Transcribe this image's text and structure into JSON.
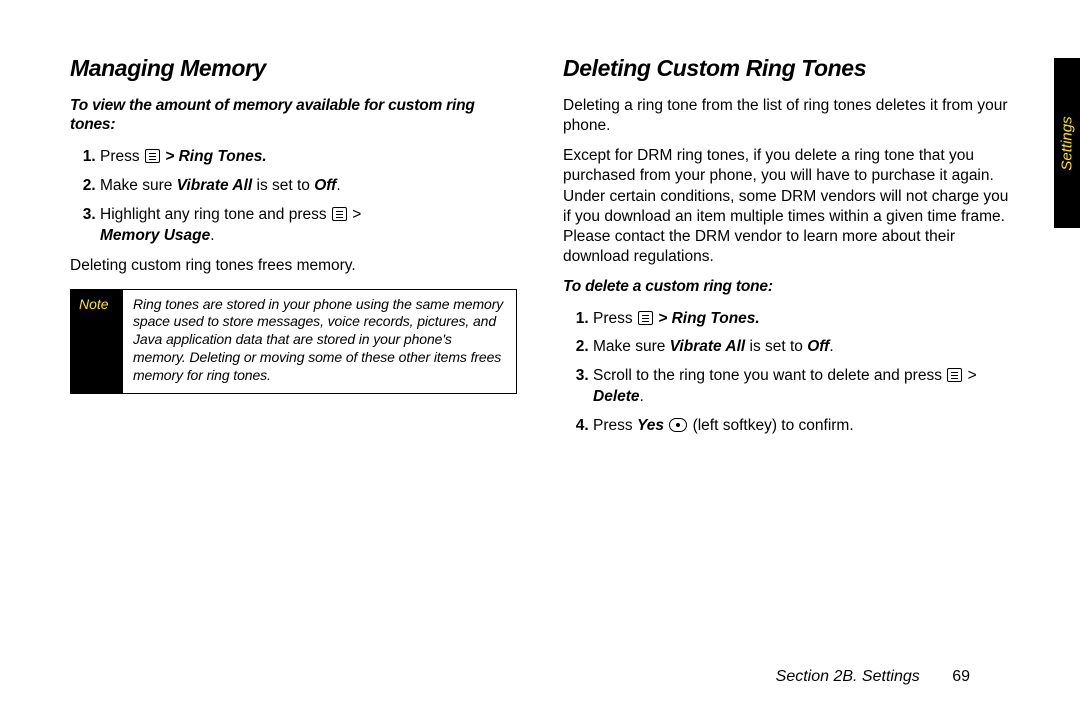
{
  "side_tab": "Settings",
  "footer": {
    "section": "Section 2B. Settings",
    "page": "69"
  },
  "left": {
    "heading": "Managing Memory",
    "intro": "To view the amount of memory available for custom ring tones:",
    "steps": {
      "s1_a": "Press ",
      "s1_b": "Ring Tones.",
      "s2_a": "Make sure ",
      "s2_b": "Vibrate All",
      "s2_c": " is set to ",
      "s2_d": "Off",
      "s2_e": ".",
      "s3_a": "Highlight any ring tone and press ",
      "s3_b": "Memory Usage",
      "s3_c": "."
    },
    "after": "Deleting custom ring tones frees memory.",
    "note_label": "Note",
    "note_body": "Ring tones are stored in your phone using the same memory space used to store messages, voice records, pictures, and Java application data that are stored in your phone's memory. Deleting or moving some of these other items frees memory for ring tones."
  },
  "right": {
    "heading": "Deleting Custom Ring Tones",
    "p1": "Deleting a ring tone from the list of ring tones deletes it from your phone.",
    "p2": "Except for DRM ring tones, if you delete a ring tone that you purchased from your phone, you will have to purchase it again. Under certain conditions, some DRM vendors will not charge you if you download an item multiple times within a given time frame. Please contact the DRM vendor to learn more about their download regulations.",
    "sub": "To delete a custom ring tone:",
    "steps": {
      "s1_a": "Press ",
      "s1_b": "Ring Tones.",
      "s2_a": "Make sure ",
      "s2_b": "Vibrate All",
      "s2_c": " is set to ",
      "s2_d": "Off",
      "s2_e": ".",
      "s3_a": "Scroll to the ring tone you want to delete and press ",
      "s3_b": "Delete",
      "s3_c": ".",
      "s4_a": "Press ",
      "s4_b": "Yes",
      "s4_c": " (left softkey) to confirm."
    }
  }
}
